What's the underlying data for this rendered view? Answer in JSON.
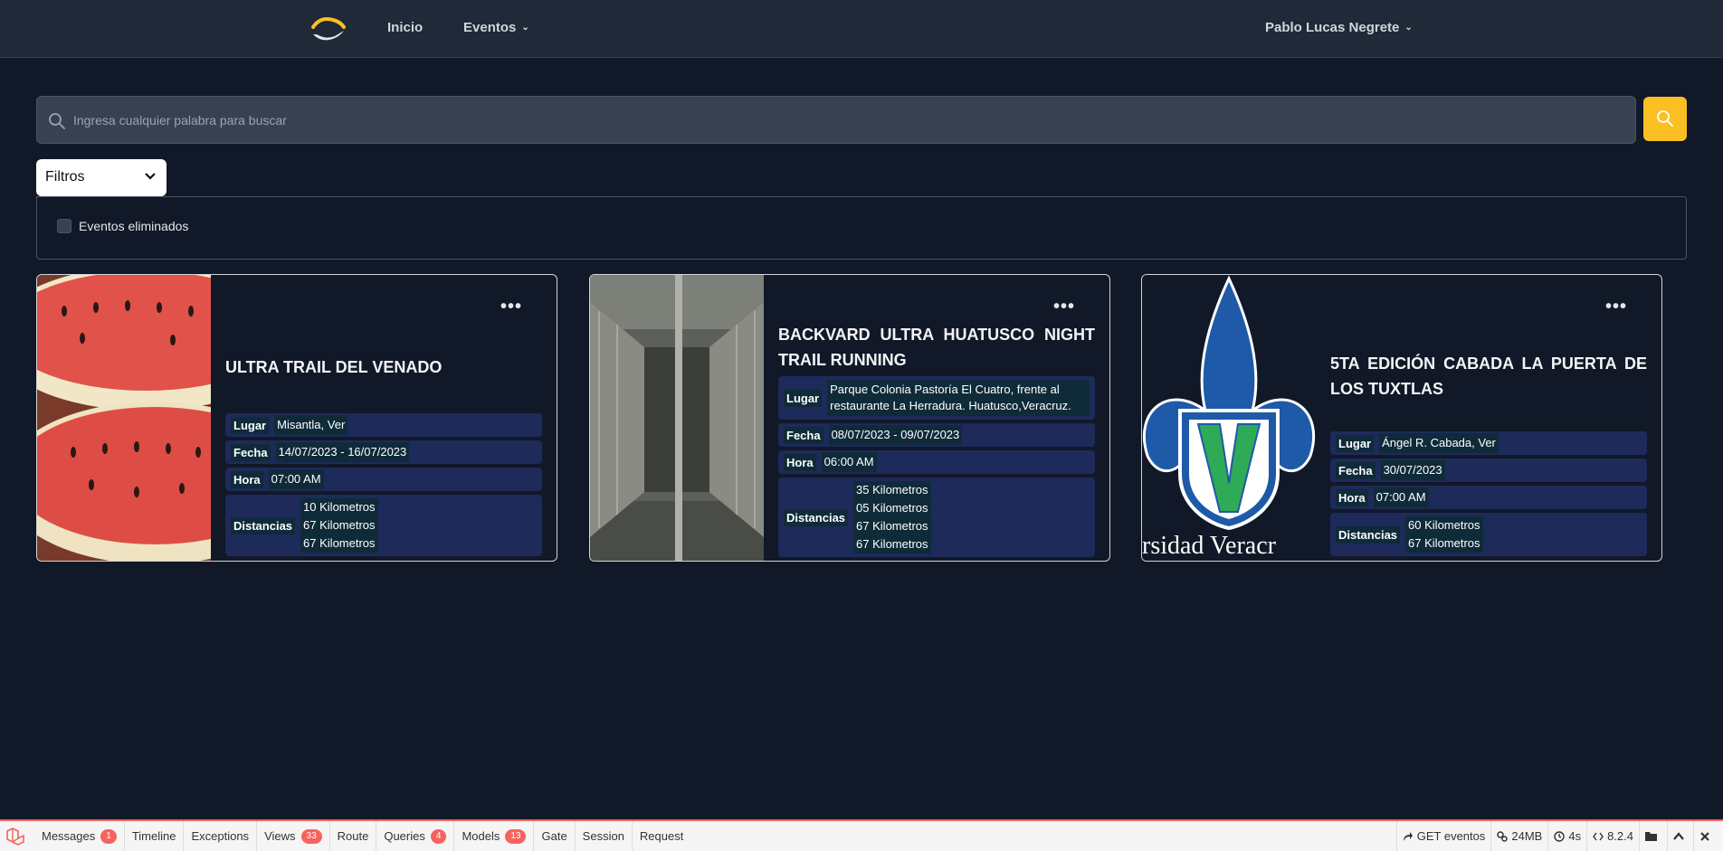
{
  "nav": {
    "home": "Inicio",
    "events": "Eventos",
    "user": "Pablo Lucas Negrete"
  },
  "search": {
    "placeholder": "Ingresa cualquier palabra para buscar"
  },
  "filters": {
    "select_value": "Filtros",
    "deleted_label": "Eventos eliminados"
  },
  "cards": [
    {
      "title": "ULTRA TRAIL DEL VENADO",
      "lugar_label": "Lugar",
      "lugar": "Misantla, Ver",
      "fecha_label": "Fecha",
      "fecha": "14/07/2023 - 16/07/2023",
      "hora_label": "Hora",
      "hora": "07:00 AM",
      "dist_label": "Distancias",
      "distancias": [
        "10 Kilometros",
        "67 Kilometros",
        "67 Kilometros"
      ]
    },
    {
      "title": "BACKVARD ULTRA HUATUSCO NIGHT TRAIL RUNNING",
      "lugar_label": "Lugar",
      "lugar": "Parque Colonia Pastoría El Cuatro, frente al restaurante La Herradura. Huatusco,Veracruz.",
      "fecha_label": "Fecha",
      "fecha": "08/07/2023 - 09/07/2023",
      "hora_label": "Hora",
      "hora": "06:00 AM",
      "dist_label": "Distancias",
      "distancias": [
        "35 Kilometros",
        "05 Kilometros",
        "67 Kilometros",
        "67 Kilometros"
      ]
    },
    {
      "title": "5TA EDICIÓN CABADA LA PUERTA DE LOS TUXTLAS",
      "image_text": "rsidad Veracr",
      "lugar_label": "Lugar",
      "lugar": "Ángel R. Cabada, Ver",
      "fecha_label": "Fecha",
      "fecha": "30/07/2023",
      "hora_label": "Hora",
      "hora": "07:00 AM",
      "dist_label": "Distancias",
      "distancias": [
        "60 Kilometros",
        "67 Kilometros"
      ]
    }
  ],
  "debugbar": {
    "tabs": [
      {
        "label": "Messages",
        "badge": "1"
      },
      {
        "label": "Timeline",
        "badge": ""
      },
      {
        "label": "Exceptions",
        "badge": ""
      },
      {
        "label": "Views",
        "badge": "33"
      },
      {
        "label": "Route",
        "badge": ""
      },
      {
        "label": "Queries",
        "badge": "4"
      },
      {
        "label": "Models",
        "badge": "13"
      },
      {
        "label": "Gate",
        "badge": ""
      },
      {
        "label": "Session",
        "badge": ""
      },
      {
        "label": "Request",
        "badge": ""
      }
    ],
    "route": "GET eventos",
    "memory": "24MB",
    "time": "4s",
    "php": "8.2.4"
  },
  "colors": {
    "background": "#111827",
    "nav": "#1f2937",
    "accent": "#fbbf24",
    "info_row": "#1e2a5a",
    "debug_red": "#f4645f"
  }
}
